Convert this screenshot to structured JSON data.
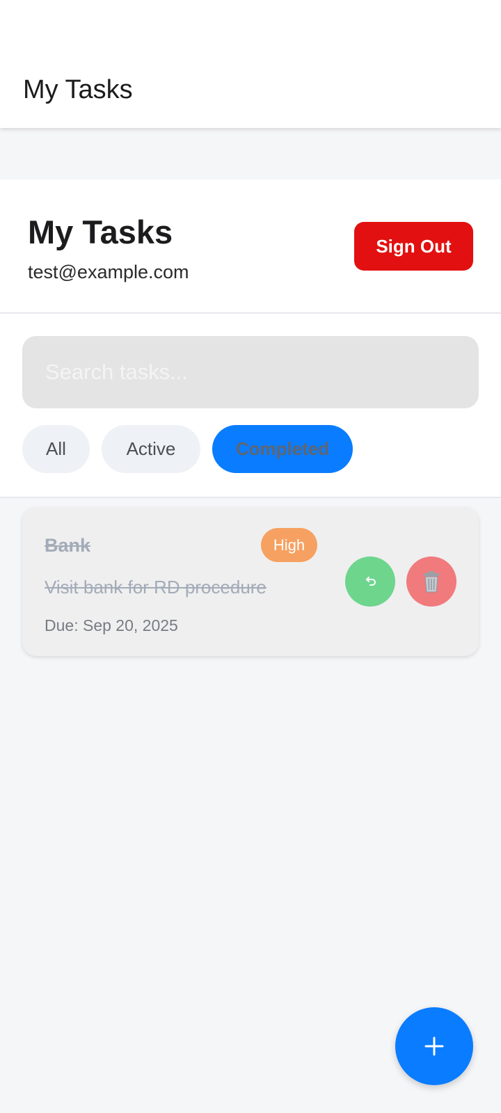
{
  "app_bar": {
    "title": "My Tasks"
  },
  "header": {
    "title": "My Tasks",
    "email": "test@example.com",
    "sign_out_label": "Sign Out"
  },
  "search": {
    "placeholder": "Search tasks..."
  },
  "filters": {
    "items": [
      {
        "label": "All"
      },
      {
        "label": "Active"
      },
      {
        "label": "Completed"
      }
    ],
    "selected": "Completed"
  },
  "tasks": [
    {
      "title": "Bank",
      "priority": "High",
      "description": "Visit bank for RD procedure",
      "due": "Due: Sep 20, 2025",
      "completed": true
    }
  ],
  "icons": {
    "undo": "undo-icon",
    "delete": "trash-icon",
    "add": "plus-icon"
  },
  "colors": {
    "accent": "#0a7cff",
    "danger": "#e21010",
    "priority_high": "#f6a161",
    "undo_green": "#6ed58d",
    "delete_red": "#f07a7c"
  }
}
